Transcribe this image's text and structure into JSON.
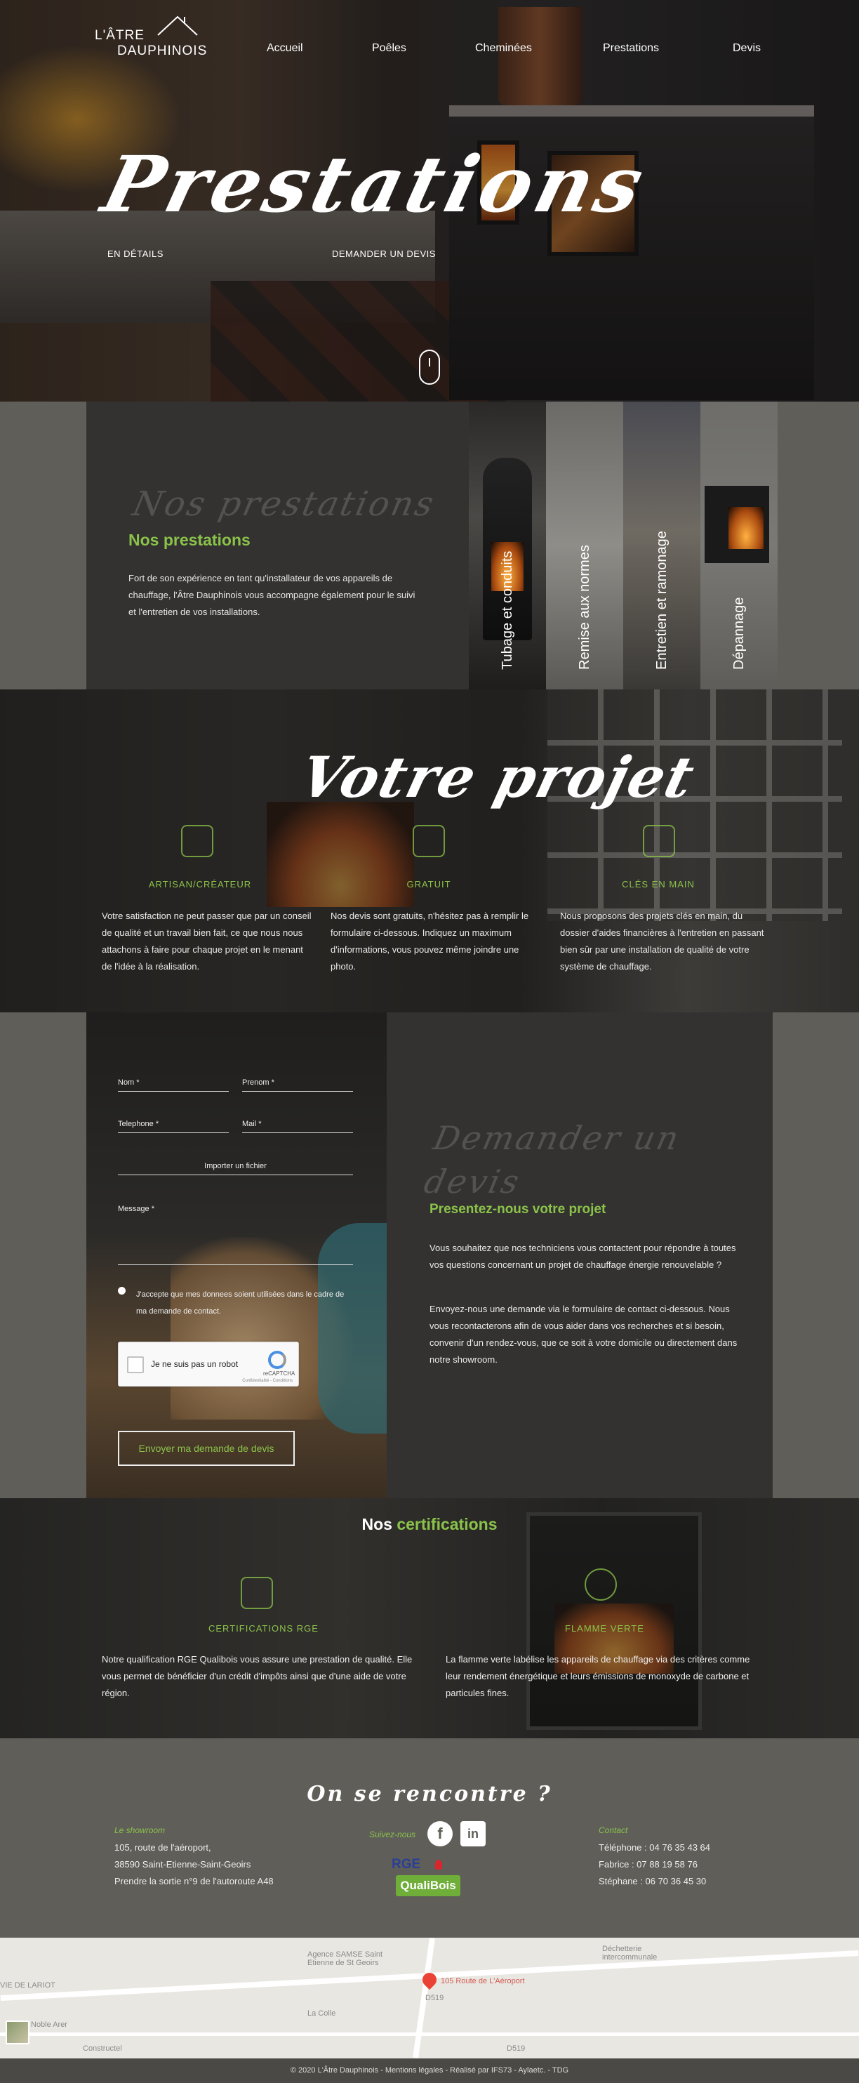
{
  "brand": {
    "line1": "L'ÂTRE",
    "line2": "DAUPHINOIS"
  },
  "nav": {
    "items": [
      "Accueil",
      "Poêles",
      "Cheminées",
      "Prestations",
      "Devis"
    ]
  },
  "hero": {
    "title": "Prestations",
    "link_details": "EN DÉTAILS",
    "link_devis": "DEMANDER UN DEVIS"
  },
  "prestations": {
    "ghost": "Nos prestations",
    "subtitle": "Nos prestations",
    "text": "Fort de son expérience en tant qu'installateur de vos appareils de chauffage, l'Âtre Dauphinois vous accompagne également pour le suivi et l'entretien de vos installations.",
    "tiles": [
      "Tubage et conduits",
      "Remise aux normes",
      "Entretien et ramonage",
      "Dépannage"
    ]
  },
  "projet": {
    "title": "Votre projet",
    "features": [
      {
        "icon": "hand-tools-icon",
        "title": "ARTISAN/CRÉATEUR",
        "text": "Votre satisfaction ne peut passer que par un conseil de qualité et un travail bien fait, ce que nous nous attachons à faire pour chaque projet en le menant de l'idée à la réalisation."
      },
      {
        "icon": "money-icon",
        "title": "GRATUIT",
        "text": "Nos devis sont gratuits, n'hésitez pas à remplir le formulaire ci-dessous. Indiquez un maximum d'informations, vous pouvez même joindre une photo."
      },
      {
        "icon": "key-hand-icon",
        "title": "CLÉS EN MAIN",
        "text": "Nous proposons des projets clés en main, du dossier d'aides financières à l'entretien en passant bien sûr par une installation de qualité de votre système de chauffage."
      }
    ]
  },
  "devis": {
    "form": {
      "nom": "Nom *",
      "prenom": "Prenom *",
      "telephone": "Telephone *",
      "mail": "Mail *",
      "fichier": "Importer un fichier",
      "message": "Message *",
      "consent": "J'accepte que mes donnees soient utilisées dans le cadre de ma demande de contact.",
      "captcha_label": "Je ne suis pas un robot",
      "captcha_brand": "reCAPTCHA",
      "captcha_links": "Confidentialité - Conditions",
      "submit": "Envoyer ma demande de devis"
    },
    "ghost": "Demander un devis",
    "subtitle": "Presentez-nous votre projet",
    "p1": "Vous souhaitez que nos techniciens vous contactent pour répondre à toutes vos questions concernant un projet de chauffage énergie renouvelable ?",
    "p2": "Envoyez-nous une demande via le formulaire de contact ci-dessous. Nous vous recontacterons afin de vous aider dans vos recherches et si besoin, convenir d'un rendez-vous, que ce soit à votre domicile ou directement dans notre showroom."
  },
  "certifications": {
    "title_a": "Nos",
    "title_b": "certifications",
    "items": [
      {
        "label": "CERTIFICATIONS RGE",
        "text": "Notre qualification RGE Qualibois vous assure une prestation de qualité. Elle vous permet de bénéficier d'un crédit d'impôts ainsi que d'une aide de votre région."
      },
      {
        "label": "FLAMME VERTE",
        "text": "La flamme verte labélise les appareils de chauffage via des critères comme leur rendement énergétique et leurs émissions de monoxyde de carbone et particules fines."
      }
    ]
  },
  "footer": {
    "title": "On se rencontre ?",
    "showroom_head": "Le showroom",
    "showroom_lines": [
      "105, route de l'aéroport,",
      "38590 Saint-Etienne-Saint-Geoirs",
      "Prendre la sortie n°9 de l'autoroute A48"
    ],
    "follow": "Suivez-nous",
    "social": [
      "f",
      "in"
    ],
    "rge_top": "RGE",
    "rge_bottom": "QualiBois",
    "contact_head": "Contact",
    "contact_lines": [
      "Téléphone : 04 76 35 43 64",
      "Fabrice : 07 88 19 58 76",
      "Stéphane : 06 70 36 45 30"
    ]
  },
  "map": {
    "labels": [
      "Agence SAMSE Saint Etienne de St Geoirs",
      "Déchetterie intercommunale",
      "VIE DE LARIOT",
      "Noble Arer",
      "La Colle",
      "Constructel",
      "D519",
      "D519"
    ],
    "pin_label": "105 Route de L'Aéroport"
  },
  "copyright": "© 2020 L'Âtre Dauphinois - Mentions légales - Réalisé par IFS73 - Aylaetc. - TDG"
}
